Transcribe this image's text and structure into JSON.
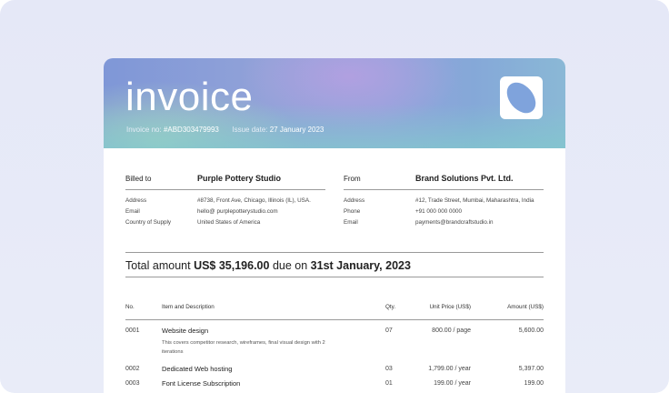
{
  "invoice": {
    "title": "invoice",
    "number_label": "Invoice no:",
    "number": "#ABD303479993",
    "date_label": "Issue date:",
    "date": "27 January 2023",
    "logo_icon": "oval-logo-icon"
  },
  "billed_to": {
    "label": "Billed to",
    "name": "Purple Pottery Studio",
    "rows": [
      {
        "key": "Address",
        "value": "#8738, Front Ave, Chicago, Illinois (IL), USA."
      },
      {
        "key": "Email",
        "value": "hello@ purplepotterystudio.com"
      },
      {
        "key": "Country of Supply",
        "value": "United States of America"
      }
    ]
  },
  "from": {
    "label": "From",
    "name": "Brand Solutions Pvt. Ltd.",
    "rows": [
      {
        "key": "Address",
        "value": "#12, Trade Street, Mumbai, Maharashtra, India"
      },
      {
        "key": "Phone",
        "value": "+91 000 000 0000"
      },
      {
        "key": "Email",
        "value": "payments@brandcraftstudio.in"
      }
    ]
  },
  "total": {
    "prefix": "Total amount",
    "amount": "US$ 35,196.00",
    "middle": "due on",
    "due_date": "31st January, 2023"
  },
  "table": {
    "headers": {
      "no": "No.",
      "item": "Item and Description",
      "qty": "Qty.",
      "unit": "Unit Price (US$)",
      "amount": "Amount (US$)"
    },
    "rows": [
      {
        "no": "0001",
        "title": "Website design",
        "desc": "This covers competitor research, wireframes, final visual design with 2 iterations",
        "qty": "07",
        "unit": "800.00 / page",
        "amount": "5,600.00"
      },
      {
        "no": "0002",
        "title": "Dedicated Web hosting",
        "desc": "",
        "qty": "03",
        "unit": "1,799.00 / year",
        "amount": "5,397.00"
      },
      {
        "no": "0003",
        "title": "Font License Subscription",
        "desc": "",
        "qty": "01",
        "unit": "199.00 / year",
        "amount": "199.00"
      }
    ]
  }
}
